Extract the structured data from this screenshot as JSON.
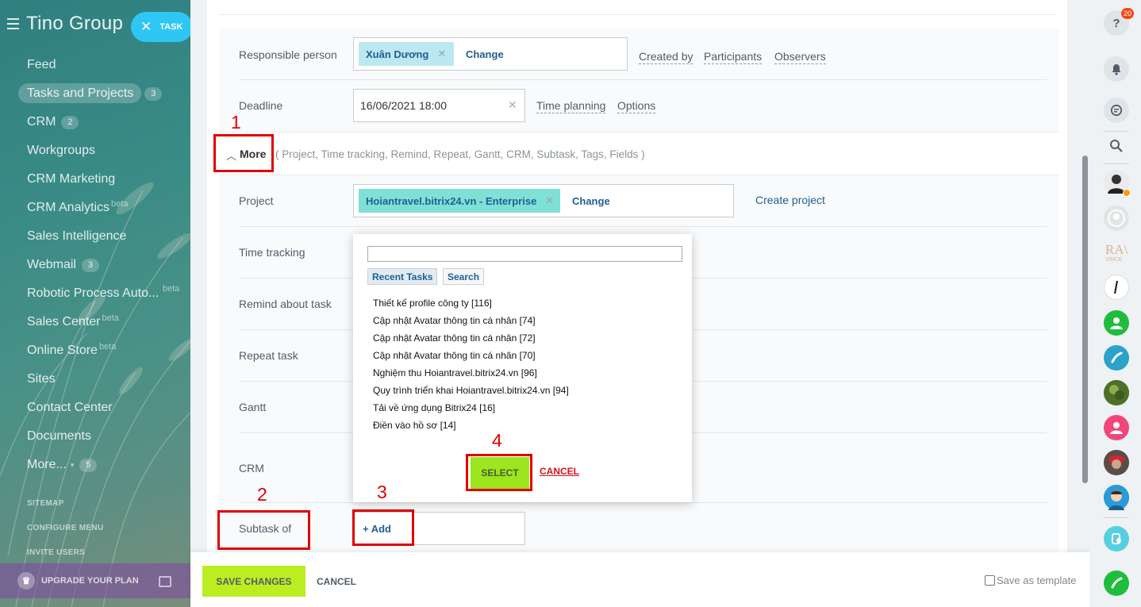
{
  "sidebar": {
    "title": "Tino Group",
    "task_button": "TASK",
    "items": [
      {
        "label": "Feed"
      },
      {
        "label": "Tasks and Projects",
        "count": "3"
      },
      {
        "label": "CRM",
        "count": "2"
      },
      {
        "label": "Workgroups"
      },
      {
        "label": "CRM Marketing"
      },
      {
        "label": "CRM Analytics",
        "beta": "beta"
      },
      {
        "label": "Sales Intelligence"
      },
      {
        "label": "Webmail",
        "count": "3"
      },
      {
        "label": "Robotic Process Auto...",
        "beta": "beta"
      },
      {
        "label": "Sales Center",
        "beta": "beta"
      },
      {
        "label": "Online Store",
        "beta": "beta"
      },
      {
        "label": "Sites"
      },
      {
        "label": "Contact Center"
      },
      {
        "label": "Documents"
      },
      {
        "label": "More...",
        "count": "5"
      }
    ],
    "sitemap": "SITEMAP",
    "configure_menu": "CONFIGURE MENU",
    "invite_users": "INVITE USERS",
    "upgrade": "UPGRADE YOUR PLAN"
  },
  "form": {
    "responsible": {
      "label": "Responsible person",
      "person": "Xuân Dương",
      "change": "Change",
      "links": [
        "Created by",
        "Participants",
        "Observers"
      ]
    },
    "deadline": {
      "label": "Deadline",
      "value": "16/06/2021 18:00",
      "links": [
        "Time planning",
        "Options"
      ]
    },
    "more": {
      "label": "More",
      "list": "( Project,  Time tracking,  Remind,  Repeat,  Gantt,  CRM,  Subtask,  Tags,  Fields )"
    },
    "project": {
      "label": "Project",
      "value": "Hoiantravel.bitrix24.vn - Enterprise",
      "change": "Change",
      "create": "Create project"
    },
    "rows": [
      "Time tracking",
      "Remind about task",
      "Repeat task",
      "Gantt",
      "CRM"
    ],
    "subtask": {
      "label": "Subtask of",
      "add": "+ Add"
    }
  },
  "popup": {
    "tabs": [
      "Recent Tasks",
      "Search"
    ],
    "tasks": [
      "Thiết kế profile công ty [116]",
      "Cập nhật Avatar thông tin cá nhân [74]",
      "Cập nhật Avatar thông tin cá nhân [72]",
      "Cập nhật Avatar thông tin cá nhân [70]",
      "Nghiệm thu Hoiantravel.bitrix24.vn [96]",
      "Quy trình triển khai Hoiantravel.bitrix24.vn [94]",
      "Tải về ứng dụng Bitrix24 [16]",
      "Điền vào hồ sơ [14]"
    ],
    "select": "SELECT",
    "cancel": "CANCEL"
  },
  "annotations": [
    "1",
    "2",
    "3",
    "4"
  ],
  "bottom": {
    "save": "SAVE CHANGES",
    "cancel": "CANCEL",
    "template": "Save as template"
  },
  "rail": {
    "help_badge": "20",
    "partial_logo_text": "RA\\",
    "partial_logo_sub": "VINCE"
  },
  "colors": {
    "accent_blue": "#2fc6f6",
    "save_green": "#bbed21",
    "select_green": "#9ce51f",
    "annotation_red": "#e00000",
    "link_blue": "#1f5f94"
  }
}
